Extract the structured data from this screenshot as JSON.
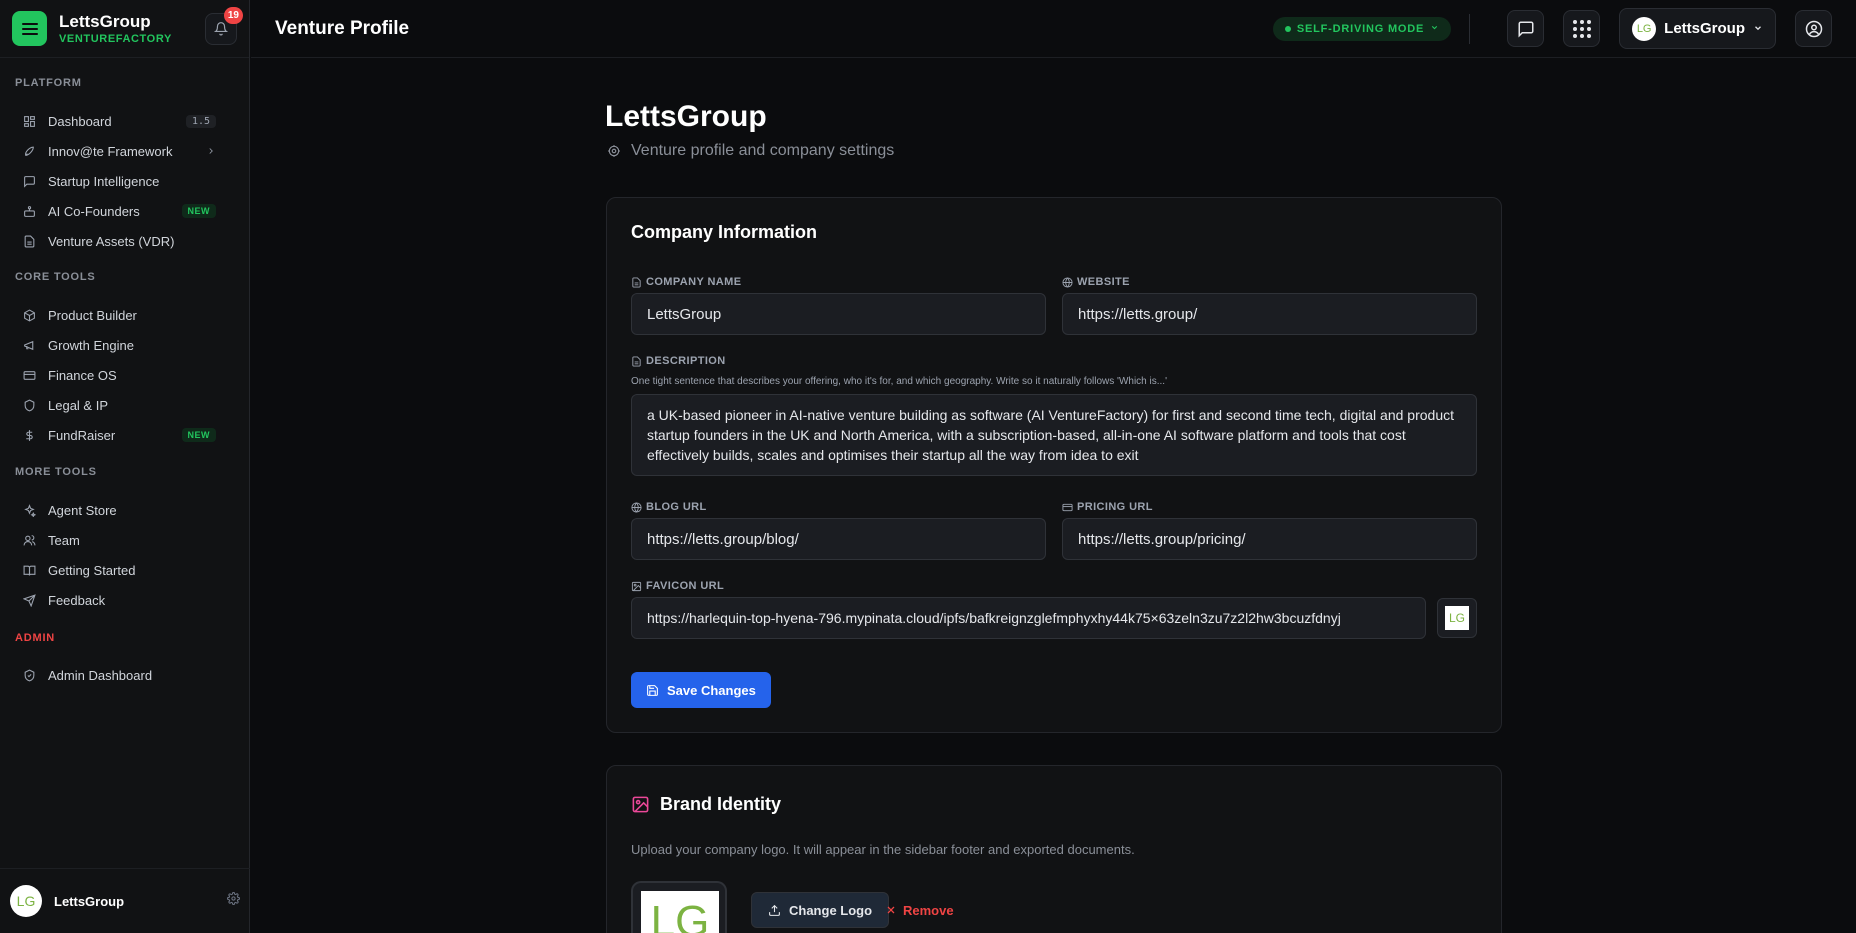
{
  "brand": {
    "name": "LettsGroup",
    "sub": "VENTUREFACTORY",
    "notifications": "19"
  },
  "sidebar": {
    "sections": {
      "platform": "PLATFORM",
      "core": "CORE TOOLS",
      "more": "MORE TOOLS",
      "admin": "ADMIN"
    },
    "platform": [
      {
        "label": "Dashboard",
        "icon": "dashboard-icon",
        "badge": "1.5"
      },
      {
        "label": "Innov@te Framework",
        "icon": "rocket-icon"
      },
      {
        "label": "Startup Intelligence",
        "icon": "message-square-icon"
      },
      {
        "label": "AI Co-Founders",
        "icon": "bot-icon",
        "badge": "NEW"
      },
      {
        "label": "Venture Assets (VDR)",
        "icon": "file-icon"
      }
    ],
    "core": [
      {
        "label": "Product Builder",
        "icon": "cube-icon"
      },
      {
        "label": "Growth Engine",
        "icon": "megaphone-icon"
      },
      {
        "label": "Finance OS",
        "icon": "credit-card-icon"
      },
      {
        "label": "Legal & IP",
        "icon": "shield-icon"
      },
      {
        "label": "FundRaiser",
        "icon": "dollar-icon",
        "badge": "NEW"
      }
    ],
    "more": [
      {
        "label": "Agent Store",
        "icon": "sparkles-icon"
      },
      {
        "label": "Team",
        "icon": "users-icon"
      },
      {
        "label": "Getting Started",
        "icon": "book-icon"
      },
      {
        "label": "Feedback",
        "icon": "send-icon"
      }
    ],
    "admin": [
      {
        "label": "Admin Dashboard",
        "icon": "shield-check-icon"
      }
    ],
    "footer": {
      "avatar": "LG",
      "name": "LettsGroup"
    }
  },
  "topbar": {
    "title": "Venture Profile",
    "mode": "SELF-DRIVING MODE",
    "org": "LettsGroup",
    "org_avatar": "LG"
  },
  "page": {
    "heading": "LettsGroup",
    "subtitle": "Venture profile and company settings"
  },
  "company": {
    "title": "Company Information",
    "name_label": "COMPANY NAME",
    "name_value": "LettsGroup",
    "website_label": "WEBSITE",
    "website_value": "https://letts.group/",
    "desc_label": "DESCRIPTION",
    "desc_hint": "One tight sentence that describes your offering, who it's for, and which geography. Write so it naturally follows 'Which is...'",
    "desc_value": "a UK-based pioneer in AI-native venture building as software (AI VentureFactory) for first and second time tech, digital and product startup founders in the UK and North America, with a subscription-based, all-in-one AI software platform and tools that cost effectively builds, scales and optimises their startup all the way from idea to exit",
    "blog_label": "BLOG URL",
    "blog_value": "https://letts.group/blog/",
    "pricing_label": "PRICING URL",
    "pricing_value": "https://letts.group/pricing/",
    "favicon_label": "FAVICON URL",
    "favicon_value": "https://harlequin-top-hyena-796.mypinata.cloud/ipfs/bafkreignzglefmphyxhy44k75×63zeln3zu7z2l2hw3bcuzfdnyj",
    "favicon_thumb": "LG",
    "save": "Save Changes"
  },
  "brand_identity": {
    "title": "Brand Identity",
    "desc": "Upload your company logo. It will appear in the sidebar footer and exported documents.",
    "logo": "LG",
    "change": "Change Logo",
    "remove": "Remove"
  },
  "colors": {
    "accent": "#22c55e",
    "primary": "#2563eb",
    "danger": "#ef4444",
    "brand_pink": "#ec4899"
  }
}
